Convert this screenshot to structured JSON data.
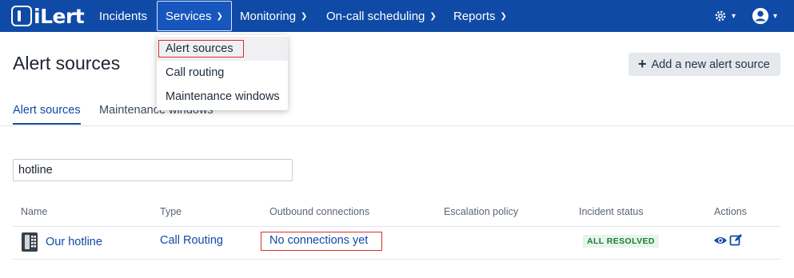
{
  "app": {
    "logo_text": "iLert"
  },
  "nav": {
    "items": [
      {
        "label": "Incidents"
      },
      {
        "label": "Services"
      },
      {
        "label": "Monitoring"
      },
      {
        "label": "On-call scheduling"
      },
      {
        "label": "Reports"
      }
    ],
    "settings_icon": "gear-icon",
    "user_icon": "user-avatar-icon"
  },
  "dropdown": {
    "items": [
      {
        "label": "Alert sources"
      },
      {
        "label": "Call routing"
      },
      {
        "label": "Maintenance windows"
      }
    ]
  },
  "page": {
    "title": "Alert sources",
    "add_button_label": "Add a new alert source"
  },
  "tabs": [
    {
      "label": "Alert sources"
    },
    {
      "label": "Maintenance windows"
    }
  ],
  "search": {
    "value": "hotline"
  },
  "table": {
    "headers": [
      "Name",
      "Type",
      "Outbound connections",
      "Escalation policy",
      "Incident status",
      "Actions"
    ],
    "rows": [
      {
        "name": "Our hotline",
        "type": "Call Routing",
        "outbound": "No connections yet",
        "escalation": "",
        "status": "ALL RESOLVED"
      }
    ]
  },
  "colors": {
    "nav_bg": "#0f4aa6",
    "link": "#0f4aa6",
    "badge_bg": "#e6f5ea",
    "badge_text": "#1e7a3a",
    "highlight": "#d8302a"
  }
}
